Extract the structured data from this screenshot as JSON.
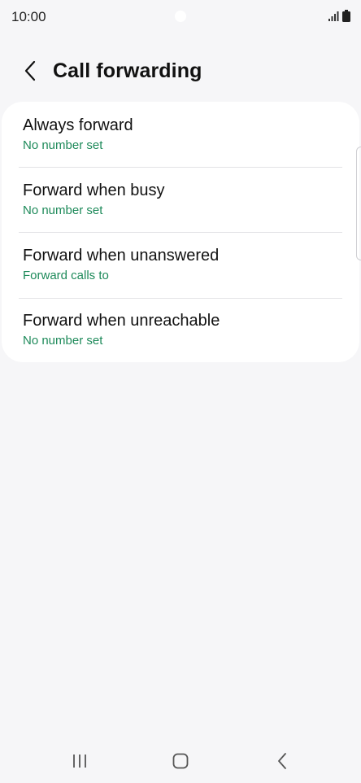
{
  "status_bar": {
    "time": "10:00",
    "icons": [
      "signal-icon",
      "battery-icon"
    ]
  },
  "header": {
    "back_icon": "chevron-left-icon",
    "title": "Call forwarding"
  },
  "settings": {
    "items": [
      {
        "title": "Always forward",
        "subtitle": "No number set"
      },
      {
        "title": "Forward when busy",
        "subtitle": "No number set"
      },
      {
        "title": "Forward when unanswered",
        "subtitle": "Forward calls to"
      },
      {
        "title": "Forward when unreachable",
        "subtitle": "No number set"
      }
    ]
  },
  "navigation": {
    "icons": [
      "recent-apps-icon",
      "home-icon",
      "back-icon"
    ]
  },
  "colors": {
    "background": "#f6f6f8",
    "card": "#ffffff",
    "subtitle_accent": "#1e8a5a",
    "text": "#111111"
  }
}
